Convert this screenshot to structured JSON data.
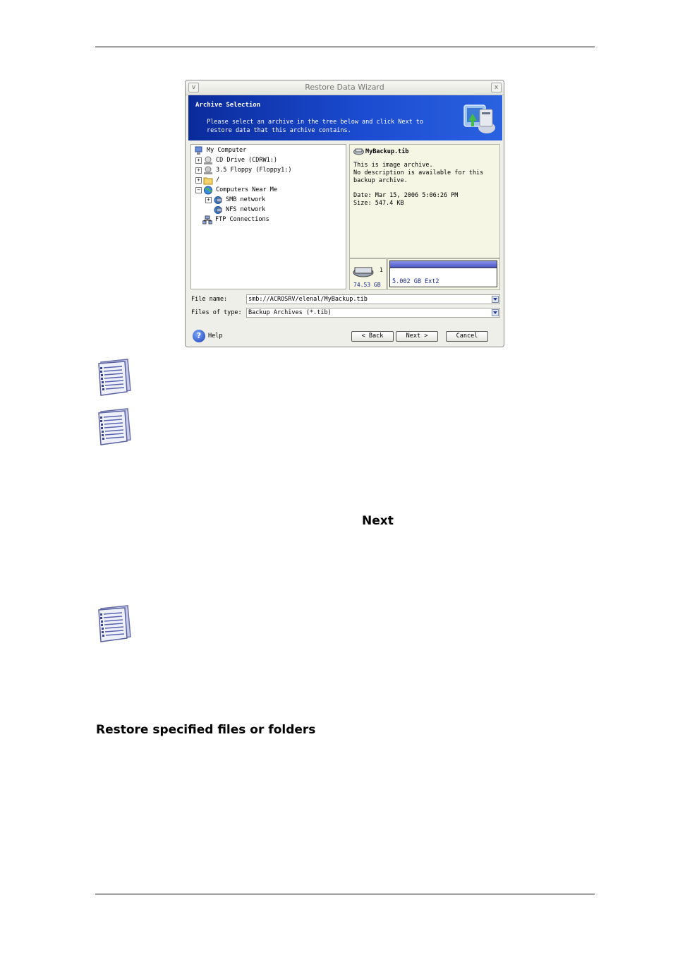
{
  "dialog": {
    "title": "Restore Data Wizard",
    "minimize_glyph": "v",
    "close_glyph": "x",
    "banner": {
      "title": "Archive Selection",
      "description_line1": "Please select an archive in the tree below and click Next to",
      "description_line2": "restore data that this archive contains."
    },
    "tree": {
      "items": [
        {
          "label": "My Computer",
          "icon": "computer-icon",
          "expander": ""
        },
        {
          "label": "CD Drive (CDRW1:)",
          "icon": "cd-drive-icon",
          "expander": "+"
        },
        {
          "label": "3.5 Floppy (Floppy1:)",
          "icon": "floppy-icon",
          "expander": "+"
        },
        {
          "label": "/",
          "icon": "folder-icon",
          "expander": "+"
        },
        {
          "label": "Computers Near Me",
          "icon": "globe-icon",
          "expander": "−"
        },
        {
          "label": "SMB network",
          "icon": "network-icon",
          "expander": "+"
        },
        {
          "label": "NFS network",
          "icon": "network-icon",
          "expander": ""
        },
        {
          "label": "FTP Connections",
          "icon": "ftp-icon",
          "expander": ""
        }
      ]
    },
    "info": {
      "archive_name": "MyBackup.tib",
      "line1": "This is image archive.",
      "line2": "No description is available for this",
      "line3": "backup archive.",
      "date": "Date: Mar 15, 2006 5:06:26 PM",
      "size": "Size: 547.4 KB"
    },
    "disk": {
      "number": "1",
      "capacity": "74.53 GB",
      "partition": "5.002 GB  Ext2"
    },
    "file_name_label": "File name:",
    "file_name_value": "smb://ACROSRV/elenal/MyBackup.tib",
    "files_of_type_label": "Files of type:",
    "files_of_type_value": "Backup Archives (*.tib)",
    "buttons": {
      "help": "Help",
      "back": "< Back",
      "next": "Next >",
      "cancel": "Cancel"
    }
  },
  "document": {
    "next_word": "Next",
    "section_heading": "Restore specified files or folders"
  }
}
